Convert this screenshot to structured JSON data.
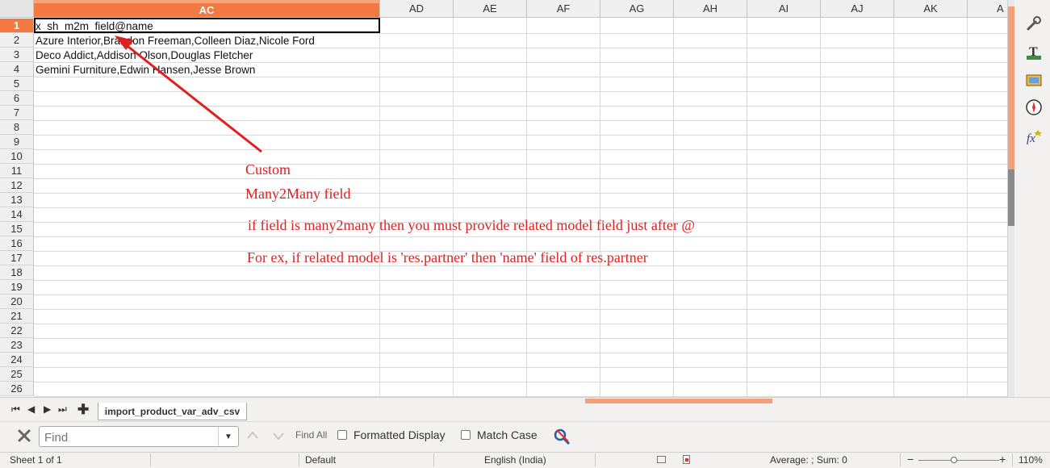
{
  "grid": {
    "columns": [
      "AC",
      "AD",
      "AE",
      "AF",
      "AG",
      "AH",
      "AI",
      "AJ",
      "AK",
      "A"
    ],
    "selected_column": "AC",
    "rows": [
      "1",
      "2",
      "3",
      "4",
      "5",
      "6",
      "7",
      "8",
      "9",
      "10",
      "11",
      "12",
      "13",
      "14",
      "15",
      "16",
      "17",
      "18",
      "19",
      "20",
      "21",
      "22",
      "23",
      "24",
      "25",
      "26"
    ],
    "selected_row": "1",
    "cells": [
      "x_sh_m2m_field@name",
      "Azure Interior,Brandon Freeman,Colleen Diaz,Nicole Ford",
      "Deco Addict,Addison Olson,Douglas Fletcher",
      "Gemini Furniture,Edwin Hansen,Jesse Brown"
    ]
  },
  "annotation": {
    "line1": "Custom",
    "line2": "Many2Many field",
    "line3": "if field is many2many then you must provide related model field just after @",
    "line4": "For ex, if related model is 'res.partner' then 'name' field of res.partner",
    "color": "#e02020"
  },
  "sidebar": {
    "icons": [
      "wrench-icon",
      "styles-icon",
      "gallery-icon",
      "navigator-icon",
      "functions-icon"
    ]
  },
  "tabs": {
    "sheet_name": "import_product_var_adv_csv"
  },
  "findbar": {
    "placeholder": "Find",
    "find_all": "Find All",
    "formatted_display": "Formatted Display",
    "match_case": "Match Case"
  },
  "status": {
    "sheet": "Sheet 1 of 1",
    "page_style": "Default",
    "language": "English (India)",
    "summary": "Average: ; Sum: 0",
    "zoom": "110%"
  },
  "colors": {
    "accent": "#f27a42",
    "annotation": "#e02020"
  }
}
